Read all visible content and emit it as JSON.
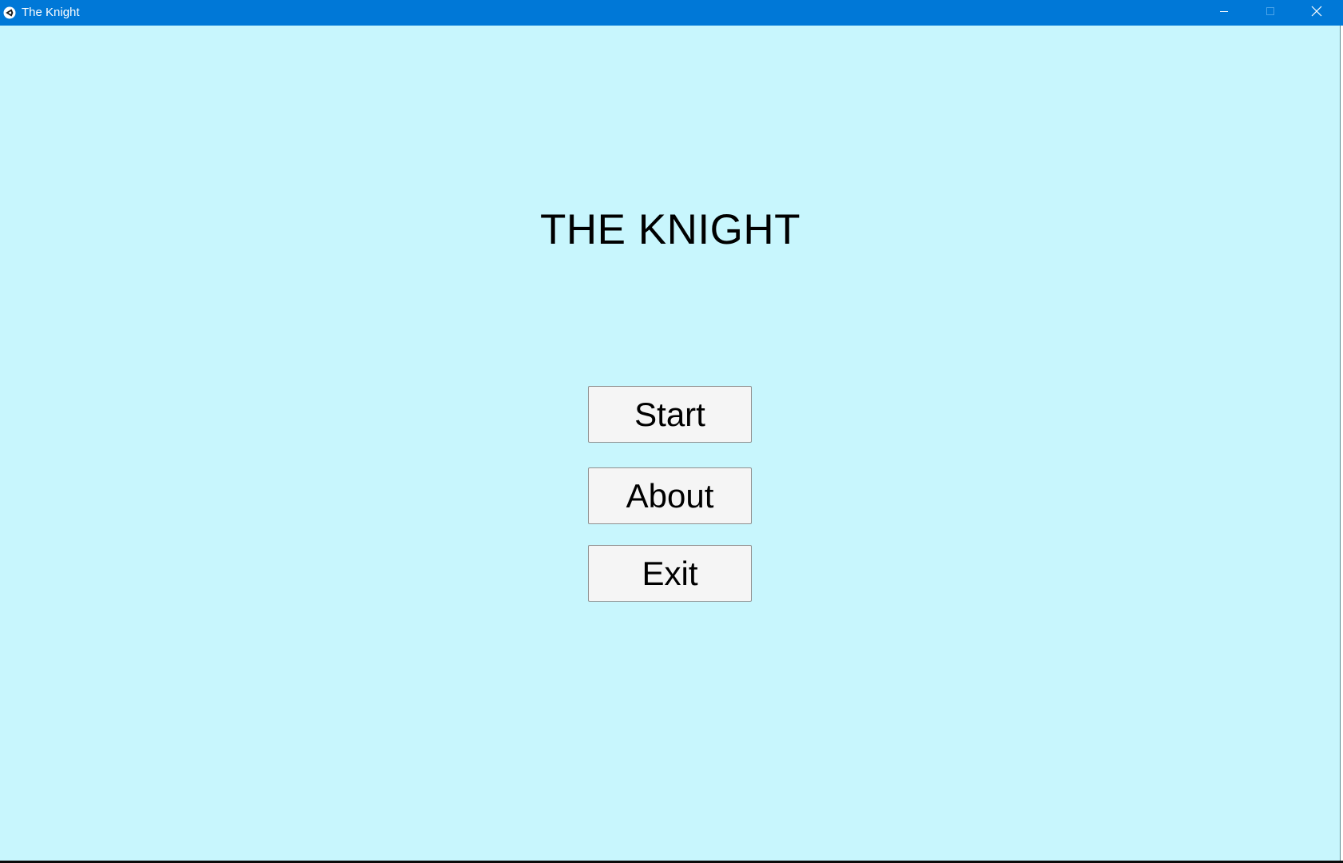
{
  "window": {
    "title": "The Knight",
    "app_icon": "unity-logo-icon",
    "controls": {
      "minimize_icon": "minimize-icon",
      "maximize_icon": "maximize-icon",
      "close_icon": "close-icon"
    },
    "colors": {
      "titlebar": "#0078d7",
      "background": "#c8f6fd"
    }
  },
  "menu": {
    "title": "THE KNIGHT",
    "buttons": [
      {
        "label": "Start"
      },
      {
        "label": "About"
      },
      {
        "label": "Exit"
      }
    ]
  }
}
